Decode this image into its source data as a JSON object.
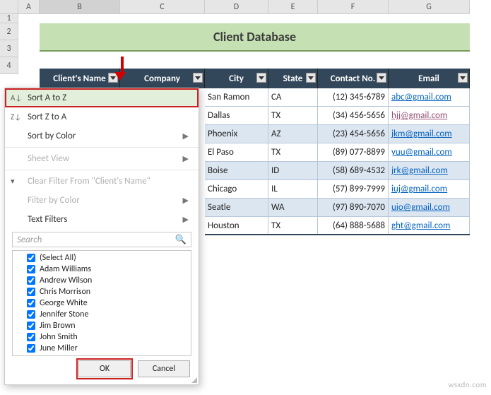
{
  "columns": [
    "A",
    "B",
    "C",
    "D",
    "E",
    "F",
    "G"
  ],
  "rows_visible": [
    "1",
    "2",
    "3",
    "4"
  ],
  "title": "Client Database",
  "headers": {
    "name": "Client's Name",
    "company": "Company",
    "city": "City",
    "state": "State",
    "contact": "Contact No.",
    "email": "Email"
  },
  "data": [
    {
      "city": "San Ramon",
      "state": "CA",
      "contact": "(12) 345-6789",
      "email": "abc@gmail.com",
      "visited": false
    },
    {
      "city": "Dallas",
      "state": "TX",
      "contact": "(34) 456-5656",
      "email": "hjj@gmail.com",
      "visited": true
    },
    {
      "city": "Phoenix",
      "state": "AZ",
      "contact": "(23) 454-5656",
      "email": "jkm@gmail.com",
      "visited": false
    },
    {
      "city": "El Paso",
      "state": "TX",
      "contact": "(89) 077-8899",
      "email": "yuu@gmail.com",
      "visited": false
    },
    {
      "city": "Boise",
      "state": "ID",
      "contact": "(58) 689-4532",
      "email": "jrk@gmail.com",
      "visited": false
    },
    {
      "city": "Chicago",
      "state": "IL",
      "contact": "(57) 899-7999",
      "email": "iuj@gmail.com",
      "visited": false
    },
    {
      "city": "Seatle",
      "state": "WA",
      "contact": "(97) 890-7070",
      "email": "uio@gmail.com",
      "visited": false
    },
    {
      "city": "Houston",
      "state": "TX",
      "contact": "(64) 888-5688",
      "email": "ght@gmail.com",
      "visited": false
    }
  ],
  "menu": {
    "sort_az": "Sort A to Z",
    "sort_za": "Sort Z to A",
    "sort_color": "Sort by Color",
    "sheet_view": "Sheet View",
    "clear_filter": "Clear Filter From \"Client's Name\"",
    "filter_color": "Filter by Color",
    "text_filters": "Text Filters",
    "search_placeholder": "Search",
    "select_all": "(Select All)",
    "items": [
      "Adam Williams",
      "Andrew Wilson",
      "Chris Morrison",
      "George White",
      "Jennifer Stone",
      "Jim Brown",
      "John Smith",
      "June Miller"
    ],
    "ok": "OK",
    "cancel": "Cancel"
  },
  "watermark": "wsxdn.com"
}
